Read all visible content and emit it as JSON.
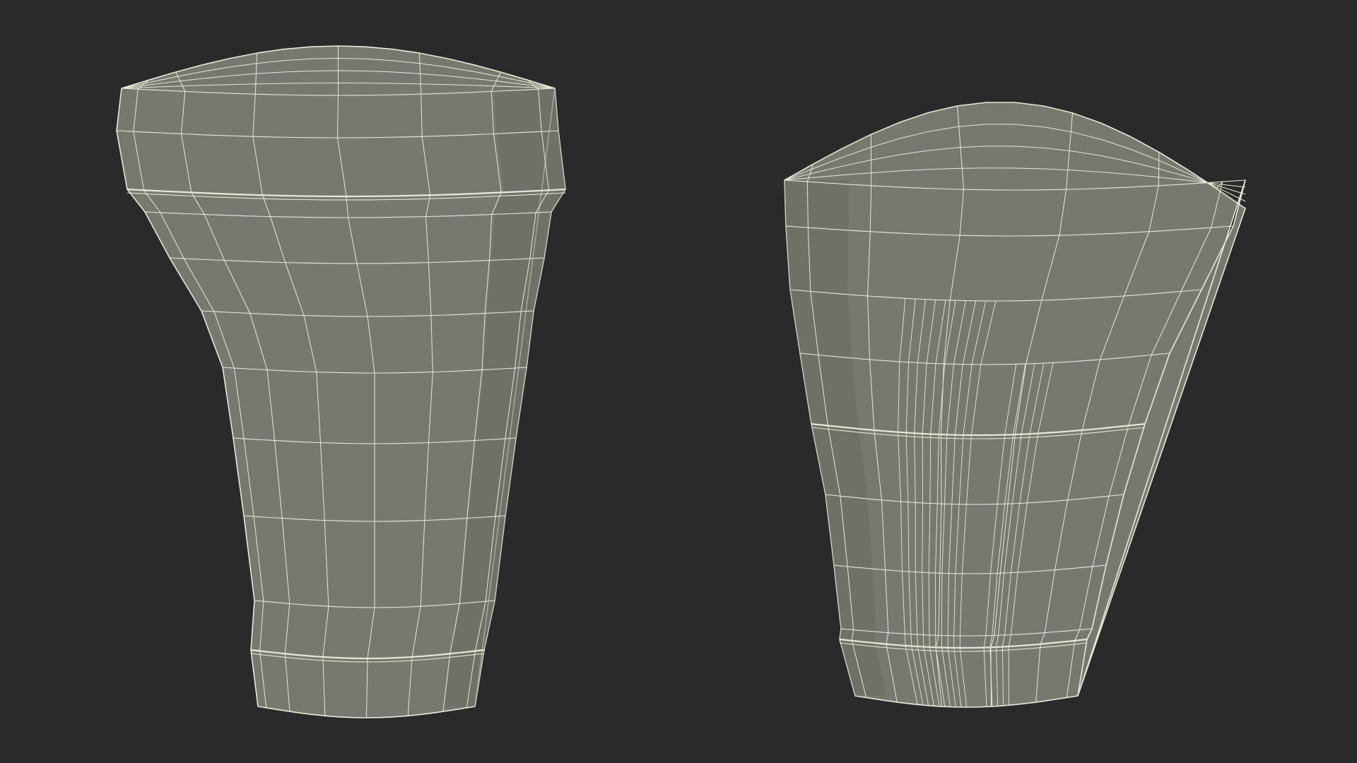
{
  "scene": {
    "background_color": "#2a2a2a",
    "mesh_fill_color": "#787870",
    "mesh_shade_color": "#6a6a62",
    "wire_color": "#e8e8d8",
    "objects": [
      {
        "name": "shift-knob-front-view",
        "view": "front"
      },
      {
        "name": "shift-knob-angled-view",
        "view": "three-quarter"
      }
    ]
  }
}
